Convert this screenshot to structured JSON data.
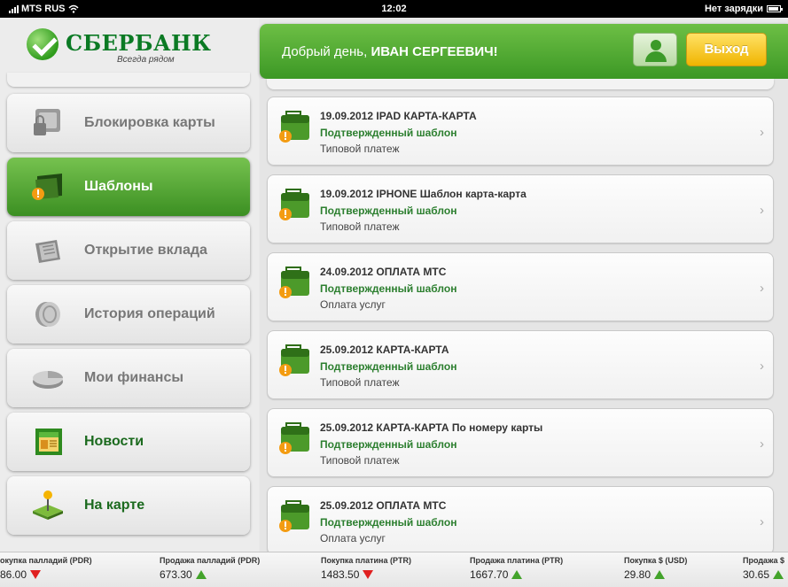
{
  "status_bar": {
    "carrier": "MTS RUS",
    "time": "12:02",
    "battery_text": "Нет зарядки"
  },
  "brand": {
    "name": "СБЕРБАНК",
    "slogan": "Всегда рядом",
    "color": "#0b7a24"
  },
  "header": {
    "greeting": "Добрый день,",
    "user_name": "ИВАН СЕРГЕЕВИЧ!",
    "exit_label": "Выход"
  },
  "sidebar": {
    "items": [
      {
        "label": "Блокировка карты",
        "icon": "card-lock-icon",
        "active": false
      },
      {
        "label": "Шаблоны",
        "icon": "folder-templates-icon",
        "active": true
      },
      {
        "label": "Открытие вклада",
        "icon": "open-deposit-icon",
        "active": false
      },
      {
        "label": "История операций",
        "icon": "history-icon",
        "active": false
      },
      {
        "label": "Мои финансы",
        "icon": "finance-pie-icon",
        "active": false
      },
      {
        "label": "Новости",
        "icon": "news-icon",
        "active": false
      },
      {
        "label": "На карте",
        "icon": "map-pin-icon",
        "active": false
      }
    ]
  },
  "templates": [
    {
      "title": "19.09.2012 IPAD КАРТА-КАРТА",
      "status": "Подтвержденный шаблон",
      "type": "Типовой платеж"
    },
    {
      "title": "19.09.2012 IPHONE Шаблон карта-карта",
      "status": "Подтвержденный шаблон",
      "type": "Типовой платеж"
    },
    {
      "title": "24.09.2012 ОПЛАТА МТС",
      "status": "Подтвержденный шаблон",
      "type": "Оплата услуг"
    },
    {
      "title": "25.09.2012 КАРТА-КАРТА",
      "status": "Подтвержденный шаблон",
      "type": "Типовой платеж"
    },
    {
      "title": "25.09.2012 КАРТА-КАРТА По номеру карты",
      "status": "Подтвержденный шаблон",
      "type": "Типовой платеж"
    },
    {
      "title": "25.09.2012 ОПЛАТА МТС",
      "status": "Подтвержденный шаблон",
      "type": "Оплата услуг"
    }
  ],
  "ticker": [
    {
      "name": "окупка палладий (PDR)",
      "value": "86.00",
      "trend": "down"
    },
    {
      "name": "Продажа палладий (PDR)",
      "value": "673.30",
      "trend": "up"
    },
    {
      "name": "Покупка платина (PTR)",
      "value": "1483.50",
      "trend": "down"
    },
    {
      "name": "Продажа платина (PTR)",
      "value": "1667.70",
      "trend": "up"
    },
    {
      "name": "Покупка $ (USD)",
      "value": "29.80",
      "trend": "up"
    },
    {
      "name": "Продажа $",
      "value": "30.65",
      "trend": "up"
    }
  ],
  "colors": {
    "accent_green": "#4ea82f",
    "exit_yellow": "#f5c400",
    "trend_up": "#43a32b",
    "trend_down": "#e02020"
  }
}
